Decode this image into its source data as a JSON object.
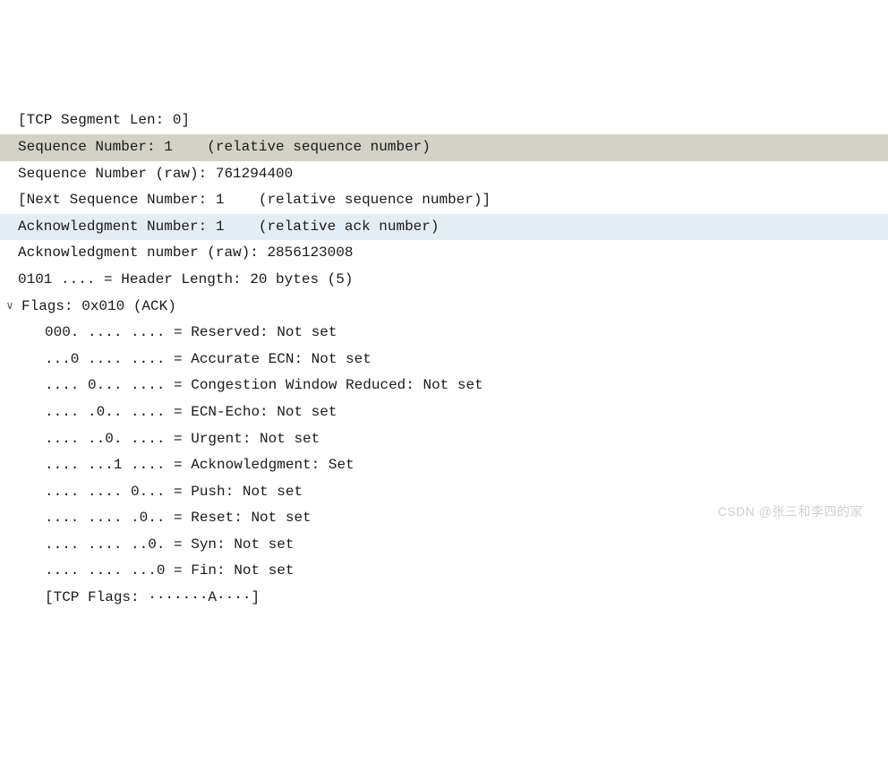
{
  "lines": [
    {
      "indent": 1,
      "text": "[TCP Segment Len: 0]",
      "hl": null,
      "marker": null
    },
    {
      "indent": 1,
      "text": "Sequence Number: 1    (relative sequence number)                                                                    ",
      "hl": "grey",
      "marker": null
    },
    {
      "indent": 1,
      "text": "Sequence Number (raw): 761294400",
      "hl": null,
      "marker": null
    },
    {
      "indent": 1,
      "text": "[Next Sequence Number: 1    (relative sequence number)]",
      "hl": null,
      "marker": null
    },
    {
      "indent": 1,
      "text": "Acknowledgment Number: 1    (relative ack number)                                                                   ",
      "hl": "blue",
      "marker": null
    },
    {
      "indent": 1,
      "text": "Acknowledgment number (raw): 2856123008",
      "hl": null,
      "marker": null
    },
    {
      "indent": 1,
      "text": "0101 .... = Header Length: 20 bytes (5)",
      "hl": null,
      "marker": null
    },
    {
      "indent": 0,
      "text": "Flags: 0x010 (ACK)",
      "hl": null,
      "marker": "v"
    },
    {
      "indent": 2,
      "text": "000. .... .... = Reserved: Not set",
      "hl": null,
      "marker": null
    },
    {
      "indent": 2,
      "text": "...0 .... .... = Accurate ECN: Not set",
      "hl": null,
      "marker": null
    },
    {
      "indent": 2,
      "text": ".... 0... .... = Congestion Window Reduced: Not set",
      "hl": null,
      "marker": null
    },
    {
      "indent": 2,
      "text": ".... .0.. .... = ECN-Echo: Not set",
      "hl": null,
      "marker": null
    },
    {
      "indent": 2,
      "text": ".... ..0. .... = Urgent: Not set",
      "hl": null,
      "marker": null
    },
    {
      "indent": 2,
      "text": ".... ...1 .... = Acknowledgment: Set",
      "hl": null,
      "marker": null
    },
    {
      "indent": 2,
      "text": ".... .... 0... = Push: Not set",
      "hl": null,
      "marker": null
    },
    {
      "indent": 2,
      "text": ".... .... .0.. = Reset: Not set",
      "hl": null,
      "marker": null
    },
    {
      "indent": 2,
      "text": ".... .... ..0. = Syn: Not set",
      "hl": null,
      "marker": null
    },
    {
      "indent": 2,
      "text": ".... .... ...0 = Fin: Not set",
      "hl": null,
      "marker": null
    },
    {
      "indent": 2,
      "text": "[TCP Flags: ·······A····]",
      "hl": null,
      "marker": null
    }
  ],
  "watermark": "CSDN @张三和李四的家"
}
